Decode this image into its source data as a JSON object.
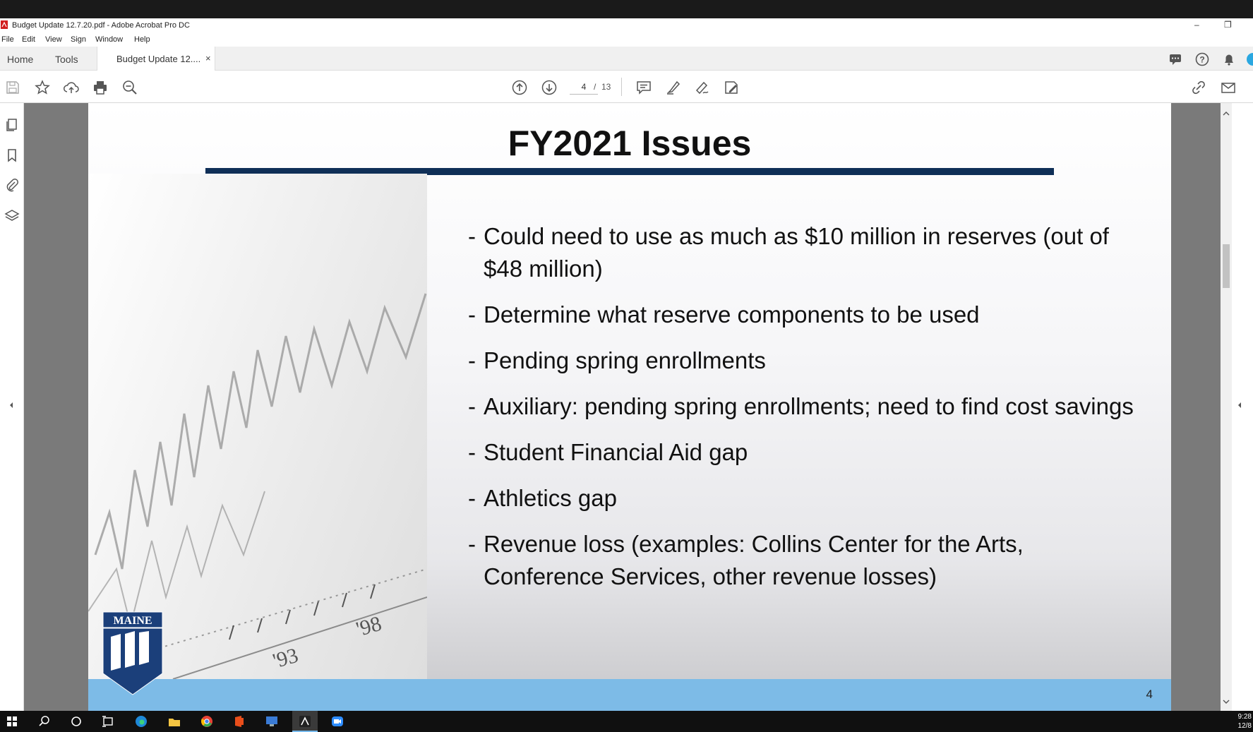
{
  "window": {
    "title": "Budget Update 12.7.20.pdf - Adobe Acrobat Pro DC",
    "minimize_glyph": "–",
    "restore_glyph": "❐"
  },
  "menu": [
    "File",
    "Edit",
    "View",
    "Sign",
    "Window",
    "Help"
  ],
  "tabs": {
    "home": "Home",
    "tools": "Tools",
    "document": "Budget Update 12....",
    "close_glyph": "×"
  },
  "toolbar": {
    "current_page": "4",
    "page_separator": "/",
    "total_pages": "13"
  },
  "slide": {
    "title": "FY2021 Issues",
    "bullets": [
      "Could need to use as much as $10 million in reserves (out of $48 million)",
      "Determine what reserve components to be used",
      "Pending spring enrollments",
      "Auxiliary: pending spring enrollments; need to find cost savings",
      "Student Financial Aid gap",
      "Athletics gap",
      "Revenue loss (examples: Collins Center for the Arts, Conference Services, other revenue losses)"
    ],
    "bullet_dash": "-",
    "page_number": "4",
    "logo_text": "MAINE",
    "photo_labels": [
      "'93",
      "'98"
    ]
  },
  "taskbar": {
    "time": "9:28",
    "date": "12/8"
  },
  "colors": {
    "title_rule": "#0f2f57",
    "footer_band": "#7dbbe7",
    "logo_blue": "#1b3f7a"
  }
}
